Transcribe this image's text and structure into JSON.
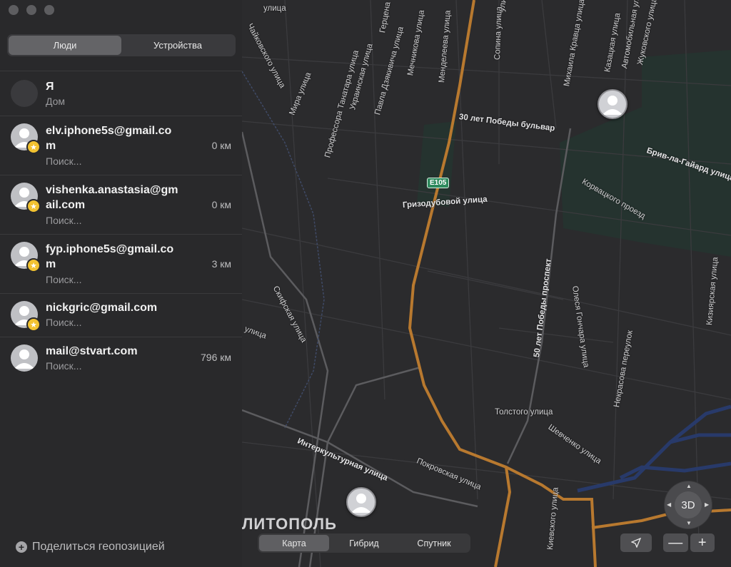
{
  "sidebar": {
    "tabs": [
      {
        "label": "Люди",
        "active": true
      },
      {
        "label": "Устройства",
        "active": false
      }
    ],
    "people": [
      {
        "name": "Я",
        "status": "Дом",
        "distance": "",
        "starred": false
      },
      {
        "name": "elv.iphone5s@gmail.com",
        "status": "Поиск...",
        "distance": "0 км",
        "starred": true
      },
      {
        "name": "vishenka.anastasia@gmail.com",
        "status": "Поиск...",
        "distance": "0 км",
        "starred": true
      },
      {
        "name": "fyp.iphone5s@gmail.com",
        "status": "Поиск...",
        "distance": "3 км",
        "starred": true
      },
      {
        "name": "nickgric@gmail.com",
        "status": "Поиск...",
        "distance": "",
        "starred": true
      },
      {
        "name": "mail@stvart.com",
        "status": "Поиск...",
        "distance": "796 км",
        "starred": false
      }
    ],
    "share_label": "Поделиться геопозицией"
  },
  "map": {
    "city_label": "ЛИТОПОЛЬ",
    "route_shield": "E105",
    "streets": [
      "Чайковского улица",
      "улица",
      "Герцена",
      "Мечникова улица",
      "Менделеева улица",
      "Сопина улица",
      "улица",
      "Михаила Кравца улица",
      "Казацкая улица",
      "Автомобильная улица",
      "Жуковского улица",
      "Мира улица",
      "Профессора Танатара улица",
      "Украинская улица",
      "Павла Дзякивича улица",
      "30 лет Победы бульвар",
      "Брив-ла-Гайард улица",
      "Корвацкого проезд",
      "Гризодубовой улица",
      "50 лет Победы проспект",
      "Олеся Гончара улица",
      "Некрасова переулок",
      "Кизиярская улица",
      "Скифская улица",
      "улица",
      "Толстого улица",
      "Шевченко улица",
      "Интеркультурная улица",
      "Покровская улица",
      "Киевского улица"
    ],
    "map_types": [
      {
        "label": "Карта",
        "active": true
      },
      {
        "label": "Гибрид",
        "active": false
      },
      {
        "label": "Спутник",
        "active": false
      }
    ],
    "compass_label": "3D",
    "zoom_out": "—",
    "zoom_in": "+"
  },
  "colors": {
    "sidebar_bg": "#29292b",
    "map_bg": "#2b2b2d",
    "primary_road": "#b8792f",
    "park": "#25332f",
    "water": "#283a6a",
    "star": "#f2c230"
  },
  "icons": [
    "person-silhouette-icon",
    "star-icon",
    "plus-icon",
    "location-arrow-icon"
  ]
}
